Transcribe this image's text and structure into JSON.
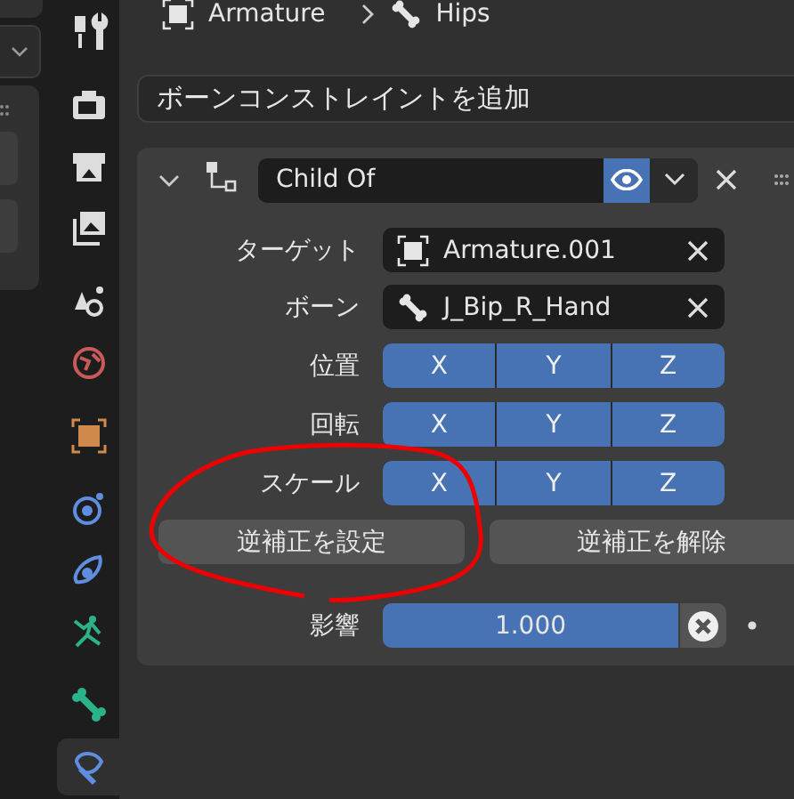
{
  "property_tabs": [
    {
      "kind": "tool",
      "selected": false
    },
    {
      "kind": "render",
      "selected": false
    },
    {
      "kind": "output",
      "selected": false
    },
    {
      "kind": "view_layer",
      "selected": false
    },
    {
      "kind": "scene",
      "selected": false
    },
    {
      "kind": "world",
      "selected": false
    },
    {
      "kind": "object",
      "selected": false
    },
    {
      "kind": "physics",
      "selected": false
    },
    {
      "kind": "object_constraint",
      "selected": false
    },
    {
      "kind": "armature",
      "selected": false
    },
    {
      "kind": "bone",
      "selected": false
    },
    {
      "kind": "bone_constraint",
      "selected": true
    }
  ],
  "breadcrumb": [
    {
      "kind": "object",
      "label": "Armature"
    },
    {
      "kind": "bone",
      "label": "Hips"
    }
  ],
  "add_button": "ボーンコンストレイントを追加",
  "constraint": {
    "expanded": true,
    "name": "Child Of",
    "visible": true,
    "fields": [
      {
        "kind": "object",
        "label": "ターゲット",
        "value": "Armature.001"
      },
      {
        "kind": "bone",
        "label": "ボーン",
        "value": "J_Bip_R_Hand"
      }
    ],
    "axes": [
      {
        "label": "位置",
        "toggles": [
          {
            "label": "X",
            "selected": true
          },
          {
            "label": "Y",
            "selected": true
          },
          {
            "label": "Z",
            "selected": true
          }
        ]
      },
      {
        "label": "回転",
        "toggles": [
          {
            "label": "X",
            "selected": true
          },
          {
            "label": "Y",
            "selected": true
          },
          {
            "label": "Z",
            "selected": true
          }
        ]
      },
      {
        "label": "スケール",
        "toggles": [
          {
            "label": "X",
            "selected": true
          },
          {
            "label": "Y",
            "selected": true
          },
          {
            "label": "Z",
            "selected": true
          }
        ]
      }
    ],
    "actions": [
      "逆補正を設定",
      "逆補正を解除"
    ],
    "influence": {
      "label": "影響",
      "value": "1.000",
      "level": 1
    }
  }
}
